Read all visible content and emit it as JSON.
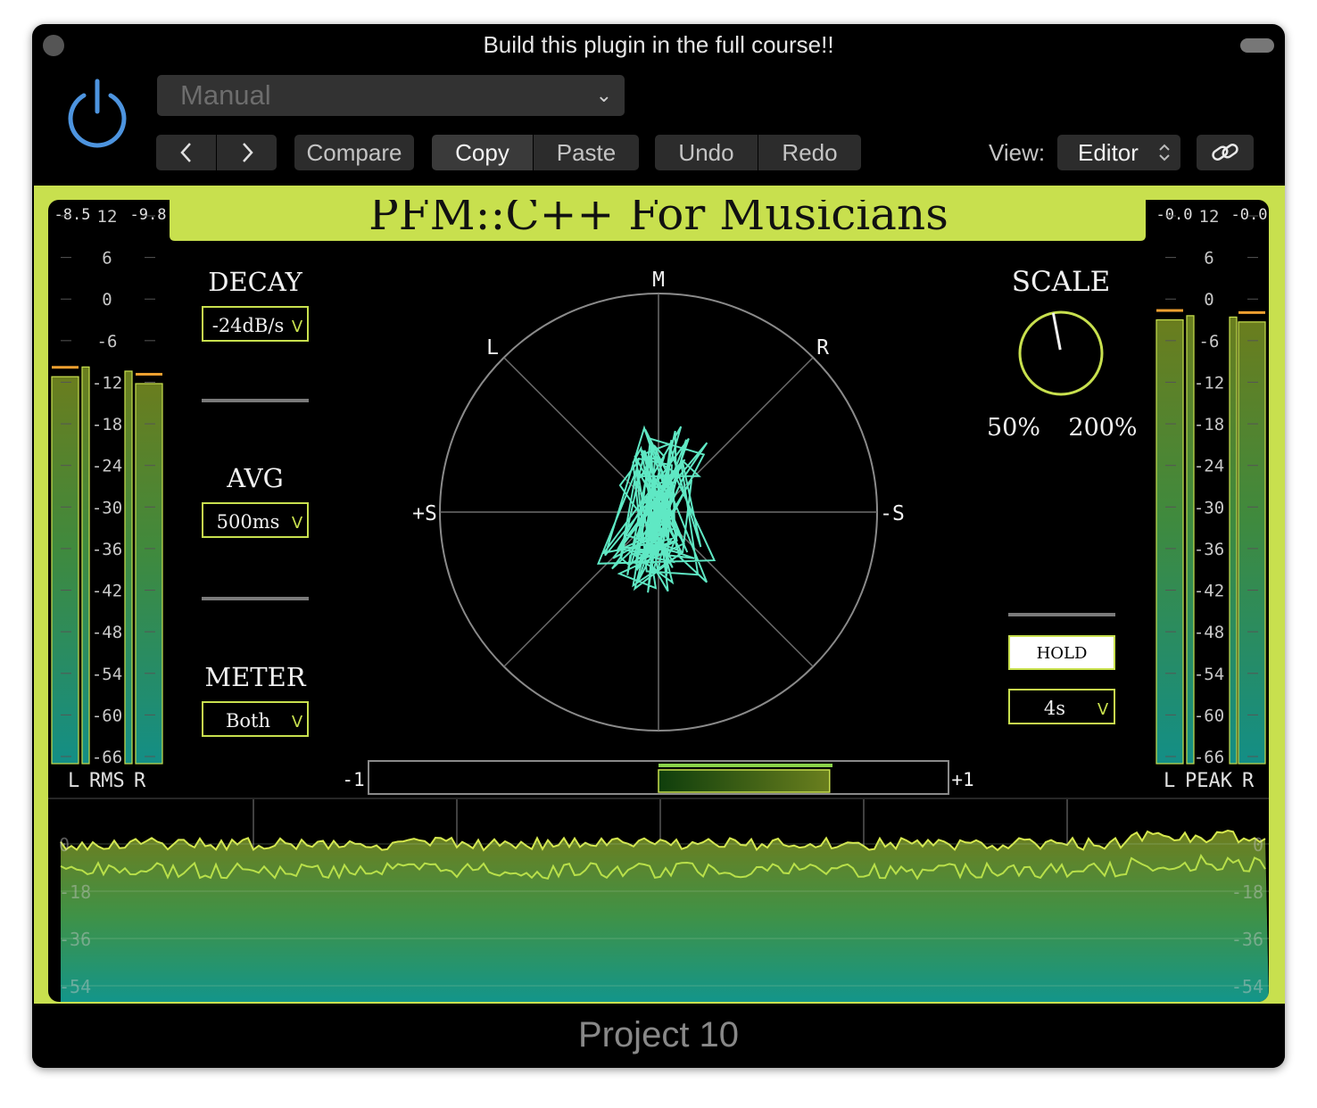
{
  "window": {
    "title": "Build this plugin in the full course!!",
    "footer": "Project 10"
  },
  "host": {
    "preset": "Manual",
    "compare_label": "Compare",
    "copy_label": "Copy",
    "paste_label": "Paste",
    "undo_label": "Undo",
    "redo_label": "Redo",
    "view_label": "View:",
    "view_value": "Editor",
    "nav_prev": "<",
    "nav_next": ">",
    "icons": [
      "power-icon",
      "chevron-left-icon",
      "chevron-right-icon",
      "chevron-down-icon",
      "updown-icon",
      "link-icon"
    ]
  },
  "plugin": {
    "title": "PFM::C++ For Musicians",
    "accent_color": "#c8e04e",
    "trace_color": "#5fe8c4",
    "rms": {
      "left_readout": "-8.5",
      "right_readout": "-9.8",
      "label_l": "L",
      "label_mid": "RMS",
      "label_r": "R",
      "left_level": -9.8,
      "right_level": -10.4,
      "left_avg": -11.2,
      "right_avg": -12.2
    },
    "peak": {
      "left_readout": "-0.0",
      "right_readout": "-0.0",
      "label_l": "L",
      "label_mid": "PEAK",
      "label_r": "R",
      "left_level": -2.4,
      "right_level": -2.6,
      "left_avg": -3.0,
      "right_avg": -3.3
    },
    "scale_ticks": [
      "12",
      "6",
      "0",
      "-6",
      "-12",
      "-18",
      "-24",
      "-30",
      "-36",
      "-42",
      "-48",
      "-54",
      "-60",
      "-66"
    ],
    "controls": {
      "decay_label": "DECAY",
      "decay_value": "-24dB/s",
      "avg_label": "AVG",
      "avg_value": "500ms",
      "meter_label": "METER",
      "meter_value": "Both",
      "scale_label": "SCALE",
      "scale_min": "50%",
      "scale_max": "200%",
      "scale_position": 0.46,
      "hold_label": "HOLD",
      "hold_value": "4s",
      "dropdown_arrow": "V"
    },
    "goniometer": {
      "label_m": "M",
      "label_l": "L",
      "label_r": "R",
      "label_ps": "+S",
      "label_ms": "-S"
    },
    "correlation": {
      "label_min": "-1",
      "label_max": "+1",
      "value": 0.59,
      "avg": 0.6
    },
    "histogram": {
      "labels_left": [
        "0",
        "-18",
        "-36",
        "-54"
      ],
      "labels_right": [
        "0",
        "-18",
        "-36",
        "-54"
      ]
    }
  }
}
